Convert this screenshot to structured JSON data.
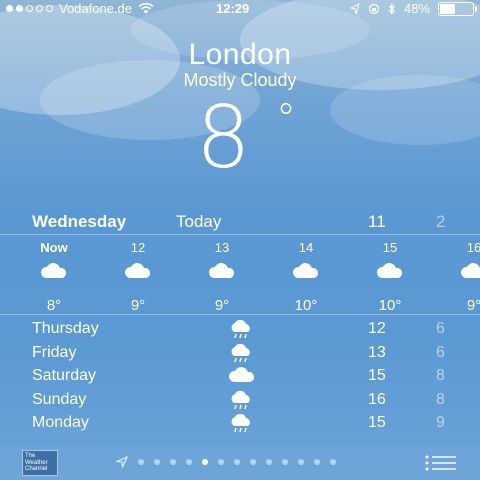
{
  "status": {
    "carrier": "Vodafone.de",
    "time": "12:29",
    "battery": "48%",
    "battery_level": 0.48,
    "signal_filled": 2,
    "signal_total": 5
  },
  "weather": {
    "city": "London",
    "condition": "Mostly Cloudy",
    "temperature": "8",
    "degree": "°"
  },
  "today": {
    "day": "Wednesday",
    "label": "Today",
    "high": "11",
    "low": "2"
  },
  "hourly": [
    {
      "time": "Now",
      "temp": "8°"
    },
    {
      "time": "12",
      "temp": "9°"
    },
    {
      "time": "13",
      "temp": "9°"
    },
    {
      "time": "14",
      "temp": "10°"
    },
    {
      "time": "15",
      "temp": "10°"
    },
    {
      "time": "16",
      "temp": "9°"
    }
  ],
  "daily": [
    {
      "day": "Thursday",
      "icon": "rain-cloud-icon",
      "high": "12",
      "low": "6"
    },
    {
      "day": "Friday",
      "icon": "rain-cloud-icon",
      "high": "13",
      "low": "6"
    },
    {
      "day": "Saturday",
      "icon": "cloud-icon",
      "high": "15",
      "low": "8"
    },
    {
      "day": "Sunday",
      "icon": "rain-cloud-icon",
      "high": "16",
      "low": "8"
    },
    {
      "day": "Monday",
      "icon": "rain-cloud-icon",
      "high": "15",
      "low": "9"
    }
  ],
  "bottom": {
    "logo_text": "The Weather Channel",
    "page_count": 13,
    "active_page": 4
  },
  "colors": {
    "sky_top": "#8fb6d6",
    "sky_bottom": "#5a98d3",
    "text": "#ffffff"
  }
}
